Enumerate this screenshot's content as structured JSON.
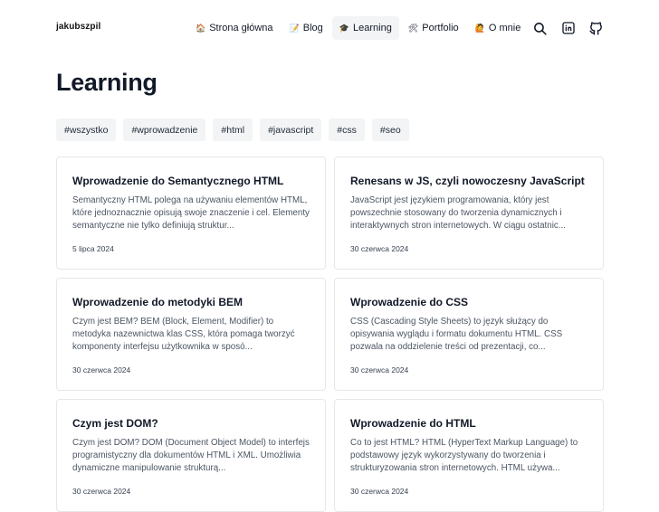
{
  "header": {
    "brand": "jakubszpil",
    "nav": [
      {
        "emoji": "🏠",
        "label": "Strona główna",
        "active": false
      },
      {
        "emoji": "📝",
        "label": "Blog",
        "active": false
      },
      {
        "emoji": "🎓",
        "label": "Learning",
        "active": true
      },
      {
        "emoji": "🛠",
        "label": "Portfolio",
        "active": false
      },
      {
        "emoji": "🙋",
        "label": "O mnie",
        "active": false
      }
    ],
    "icons": [
      "search-icon",
      "linkedin-icon",
      "github-icon"
    ]
  },
  "page": {
    "title": "Learning"
  },
  "tags": [
    "#wszystko",
    "#wprowadzenie",
    "#html",
    "#javascript",
    "#css",
    "#seo"
  ],
  "cards": [
    {
      "title": "Wprowadzenie do Semantycznego HTML",
      "description": "Semantyczny HTML polega na używaniu elementów HTML, które jednoznacznie opisują swoje znaczenie i cel. Elementy semantyczne nie tylko definiują struktur...",
      "date": "5 lipca 2024"
    },
    {
      "title": "Renesans w JS, czyli nowoczesny JavaScript",
      "description": "JavaScript jest językiem programowania, który jest powszechnie stosowany do tworzenia dynamicznych i interaktywnych stron internetowych. W ciągu ostatnic...",
      "date": "30 czerwca 2024"
    },
    {
      "title": "Wprowadzenie do metodyki BEM",
      "description": "Czym jest BEM? BEM (Block, Element, Modifier) to metodyka nazewnictwa klas CSS, która pomaga tworzyć komponenty interfejsu użytkownika w sposó...",
      "date": "30 czerwca 2024"
    },
    {
      "title": "Wprowadzenie do CSS",
      "description": "CSS (Cascading Style Sheets) to język służący do opisywania wyglądu i formatu dokumentu HTML. CSS pozwala na oddzielenie treści od prezentacji, co...",
      "date": "30 czerwca 2024"
    },
    {
      "title": "Czym jest DOM?",
      "description": "Czym jest DOM? DOM (Document Object Model) to interfejs programistyczny dla dokumentów HTML i XML. Umożliwia dynamiczne manipulowanie strukturą...",
      "date": "30 czerwca 2024"
    },
    {
      "title": "Wprowadzenie do HTML",
      "description": "Co to jest HTML? HTML (HyperText Markup Language) to podstawowy język wykorzystywany do tworzenia i strukturyzowania stron internetowych. HTML używa...",
      "date": "30 czerwca 2024"
    }
  ]
}
